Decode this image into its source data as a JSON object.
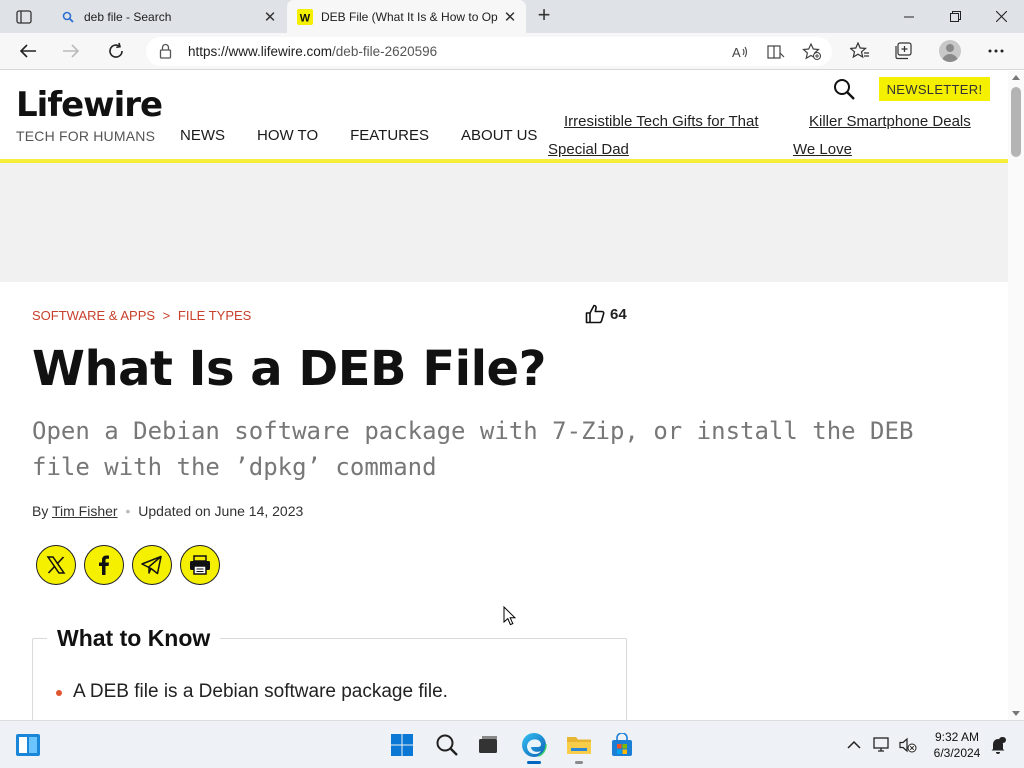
{
  "browser": {
    "tabs": [
      {
        "title": "deb file - Search",
        "active": false
      },
      {
        "title": "DEB File (What It Is & How to Op",
        "active": true
      }
    ],
    "url_host": "https://www.lifewire.com",
    "url_path": "/deb-file-2620596"
  },
  "site": {
    "logo": "Lifewire",
    "tagline": "TECH FOR HUMANS",
    "nav": [
      "NEWS",
      "HOW TO",
      "FEATURES",
      "ABOUT US"
    ],
    "promo1_line1": "Irresistible Tech Gifts for That",
    "promo1_line2": "Special Dad",
    "promo2_line1": "Killer Smartphone Deals",
    "promo2_line2": "We Love",
    "newsletter": "NEWSLETTER!",
    "accent_color": "#f5ef00"
  },
  "article": {
    "breadcrumb": [
      "SOFTWARE & APPS",
      ">",
      "FILE TYPES"
    ],
    "likes": "64",
    "title": "What Is a DEB File?",
    "subtitle": "Open a Debian software package with 7-Zip, or install the DEB file with the ’dpkg’ command",
    "by": "By",
    "author": "Tim Fisher",
    "updated": "Updated on June 14, 2023",
    "share_icons": [
      "x-icon",
      "facebook-icon",
      "telegram-icon",
      "print-icon"
    ],
    "what_to_know_title": "What to Know",
    "what_to_know": [
      "A DEB file is a Debian software package file."
    ]
  },
  "taskbar": {
    "time": "9:32 AM",
    "date": "6/3/2024"
  }
}
